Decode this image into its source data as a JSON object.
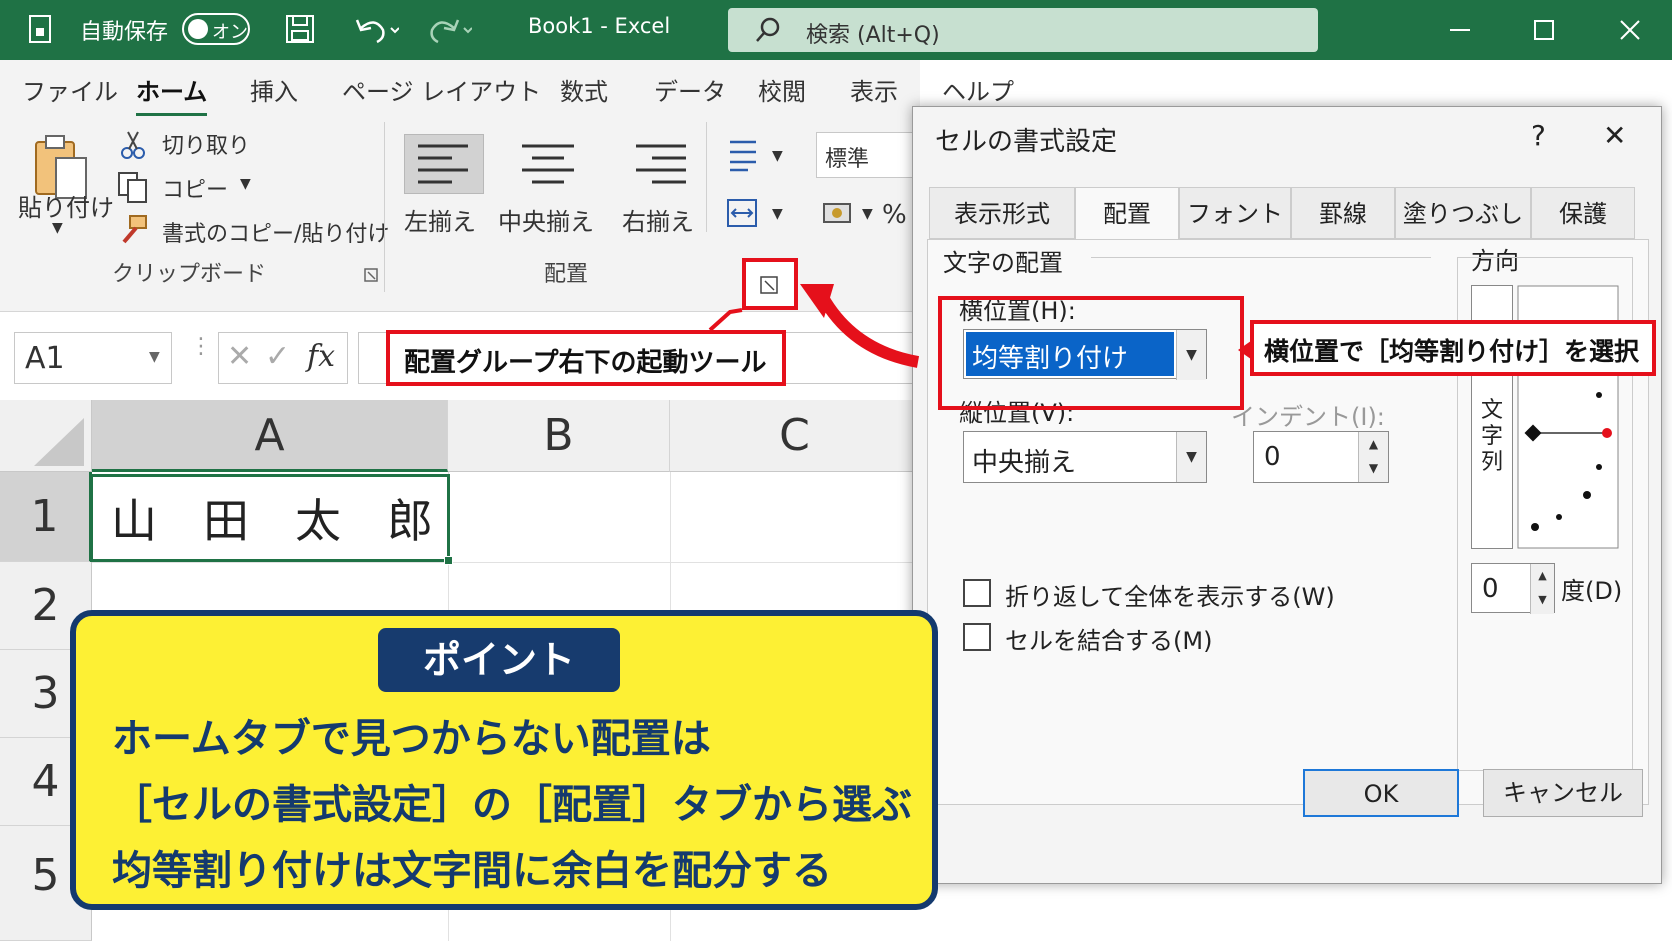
{
  "title_bar": {
    "autosave_label": "自動保存",
    "autosave_state": "オン",
    "doc_title": "Book1  -  Excel",
    "search_placeholder": "検索 (Alt+Q)"
  },
  "ribbon": {
    "tabs": [
      "ファイル",
      "ホーム",
      "挿入",
      "ページ レイアウト",
      "数式",
      "データ",
      "校閲",
      "表示",
      "ヘルプ"
    ],
    "active_tab": "ホーム",
    "clipboard": {
      "paste": "貼り付け",
      "cut": "切り取り",
      "copy": "コピー",
      "format_painter": "書式のコピー/貼り付け",
      "group": "クリップボード"
    },
    "alignment": {
      "left": "左揃え",
      "center": "中央揃え",
      "right": "右揃え",
      "group": "配置"
    },
    "number_format": "標準",
    "percent_symbol": "%"
  },
  "formula_bar": {
    "name_box": "A1",
    "fx": "fx"
  },
  "sheet": {
    "columns": [
      "A",
      "B",
      "C"
    ],
    "rows": [
      "1",
      "2",
      "3",
      "4",
      "5"
    ],
    "cell_a1": [
      "山",
      "田",
      "太",
      "郎"
    ]
  },
  "dialog": {
    "title": "セルの書式設定",
    "help": "?",
    "close": "✕",
    "tabs": [
      "表示形式",
      "配置",
      "フォント",
      "罫線",
      "塗りつぶし",
      "保護"
    ],
    "active_tab": "配置",
    "section_alignment": "文字の配置",
    "horizontal_label": "横位置(H):",
    "horizontal_value": "均等割り付け",
    "vertical_label": "縦位置(V):",
    "vertical_value": "中央揃え",
    "indent_label": "インデント(I):",
    "indent_value": "0",
    "orientation_label": "方向",
    "vertical_text": "文字列",
    "degree_value": "0",
    "degree_label": "度(D)",
    "wrap_label": "折り返して全体を表示する(W)",
    "merge_label": "セルを結合する(M)",
    "ok": "OK",
    "cancel": "キャンセル"
  },
  "annotations": {
    "launcher_callout": "配置グループ右下の起動ツール",
    "horizontal_callout": "横位置で［均等割り付け］を選択",
    "point_badge": "ポイント",
    "point_lines": [
      "ホームタブで見つからない配置は",
      "［セルの書式設定］の［配置］タブから選ぶ",
      "均等割り付けは文字間に余白を配分する"
    ]
  },
  "colors": {
    "excel_green": "#1f7245",
    "callout_red": "#e5101b",
    "point_yellow": "#fdf034",
    "point_navy": "#143a6e",
    "selection_blue": "#0a64c8"
  }
}
